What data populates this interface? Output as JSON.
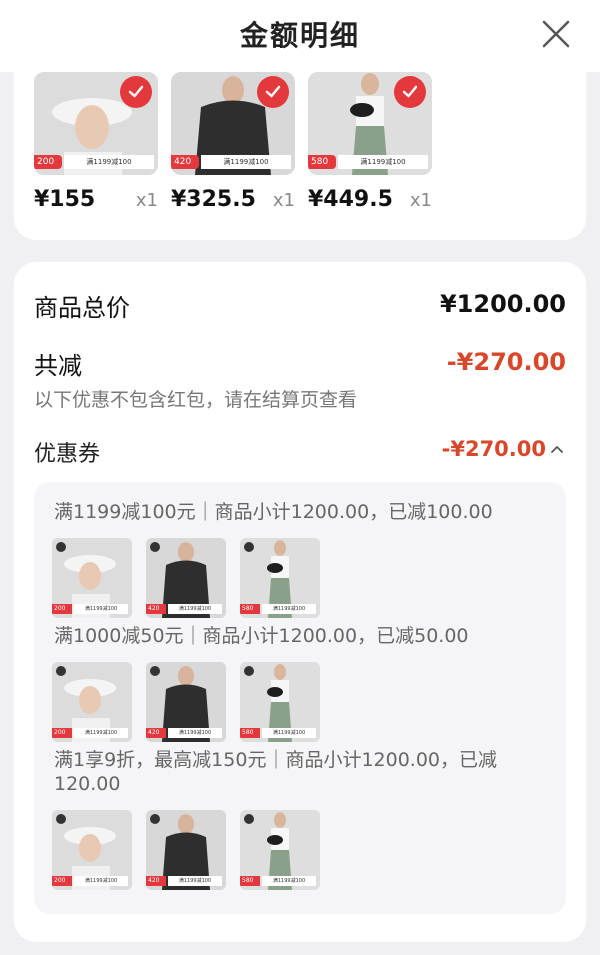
{
  "header": {
    "title": "金额明细"
  },
  "products": [
    {
      "name": "bucket-hat",
      "price": "¥155",
      "qty": "x1",
      "badge": "200",
      "promo": "满1199减100"
    },
    {
      "name": "black-longsleeve",
      "price": "¥325.5",
      "qty": "x1",
      "badge": "420",
      "promo": "满1199减100"
    },
    {
      "name": "crossbody-bag",
      "price": "¥449.5",
      "qty": "x1",
      "badge": "580",
      "promo": "满1199减100"
    }
  ],
  "summary": {
    "total_label": "商品总价",
    "total_value": "¥1200.00",
    "discount_label": "共减",
    "discount_value": "-¥270.00",
    "note": "以下优惠不包含红包，请在结算页查看",
    "coupon_label": "优惠券",
    "coupon_value": "-¥270.00"
  },
  "coupon_rules": [
    {
      "text": "满1199减100元｜商品小计1200.00，已减100.00"
    },
    {
      "text": "满1000减50元｜商品小计1200.00，已减50.00"
    },
    {
      "text": "满1享9折，最高减150元｜商品小计1200.00，已减120.00"
    }
  ],
  "colors": {
    "accent": "#e4393c",
    "discount": "#d9472b",
    "background": "#f0f0f2"
  },
  "icons": {
    "close": "close-icon",
    "check": "check-icon",
    "chevron": "chevron-up-icon"
  }
}
